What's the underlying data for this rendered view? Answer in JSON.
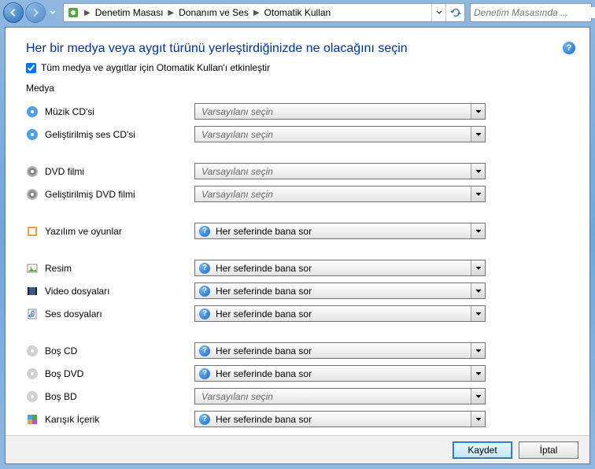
{
  "nav": {
    "breadcrumbs": [
      "Denetim Masası",
      "Donanım ve Ses",
      "Otomatik Kullan"
    ]
  },
  "search": {
    "placeholder": "Denetim Masasında ..."
  },
  "page": {
    "title": "Her bir medya veya aygıt türünü yerleştirdiğinizde ne olacağını seçin",
    "enable_checkbox_label": "Tüm medya ve aygıtlar için Otomatik Kullan'ı etkinleştir",
    "enable_checked": true,
    "section_label": "Medya"
  },
  "options": {
    "default": "Varsayılanı seçin",
    "ask": "Her seferinde bana sor"
  },
  "media_items": [
    {
      "icon": "disc-blue",
      "label": "Müzik CD'si",
      "value": "default"
    },
    {
      "icon": "disc-blue",
      "label": "Geliştirilmiş ses CD'si",
      "value": "default"
    },
    {
      "gap": true
    },
    {
      "icon": "disc-dvd",
      "label": "DVD filmi",
      "value": "default"
    },
    {
      "icon": "disc-dvd",
      "label": "Geliştirilmiş DVD filmi",
      "value": "default"
    },
    {
      "gap": true
    },
    {
      "icon": "software",
      "label": "Yazılım ve oyunlar",
      "value": "ask"
    },
    {
      "gap": true
    },
    {
      "icon": "picture",
      "label": "Resim",
      "value": "ask"
    },
    {
      "icon": "video",
      "label": "Video dosyaları",
      "value": "ask"
    },
    {
      "icon": "audio",
      "label": "Ses dosyaları",
      "value": "ask"
    },
    {
      "gap": true
    },
    {
      "icon": "disc-silver",
      "label": "Boş CD",
      "value": "ask"
    },
    {
      "icon": "disc-silver",
      "label": "Boş DVD",
      "value": "ask"
    },
    {
      "icon": "disc-silver",
      "label": "Boş BD",
      "value": "default"
    },
    {
      "icon": "mixed",
      "label": "Karışık İçerik",
      "value": "ask"
    }
  ],
  "footer": {
    "save": "Kaydet",
    "cancel": "İptal"
  }
}
